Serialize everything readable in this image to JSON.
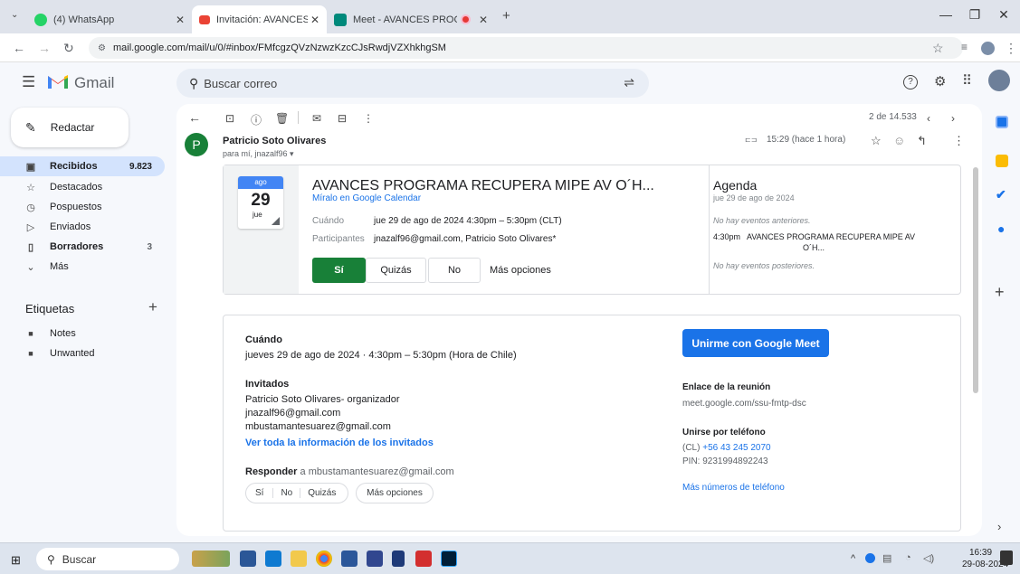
{
  "browser": {
    "tabs": [
      {
        "title": "(4) WhatsApp",
        "icon_color": "#25d366",
        "active": false
      },
      {
        "title": "Invitación: AVANCES PROGRAM",
        "icon_color": "#ea4335",
        "active": true
      },
      {
        "title": "Meet - AVANCES PROGRAM",
        "icon_color": "#00897b",
        "active": false
      }
    ],
    "new_tab": "+",
    "url": "mail.google.com/mail/u/0/#inbox/FMfcgzQVzNzwzKzcCJsRwdjVZXhkhgSM"
  },
  "gmail": {
    "logo_text": "Gmail",
    "search_placeholder": "Buscar correo"
  },
  "sidebar": {
    "compose": "Redactar",
    "items": [
      {
        "label": "Recibidos",
        "count": "9.823",
        "icon": "inbox-icon",
        "selected": true
      },
      {
        "label": "Destacados",
        "count": "",
        "icon": "star-icon"
      },
      {
        "label": "Pospuestos",
        "count": "",
        "icon": "clock-icon"
      },
      {
        "label": "Enviados",
        "count": "",
        "icon": "send-icon"
      },
      {
        "label": "Borradores",
        "count": "3",
        "icon": "draft-icon"
      },
      {
        "label": "Más",
        "count": "",
        "icon": "chevron-down-icon"
      }
    ],
    "labels_heading": "Etiquetas",
    "labels_add": "+",
    "labels": [
      {
        "label": "Notes"
      },
      {
        "label": "Unwanted"
      }
    ]
  },
  "toolbar": {
    "pagination": "2 de 14.533"
  },
  "message": {
    "avatar_letter": "P",
    "sender": "Patricio Soto Olivares",
    "recipient": "para mí, jnazalf96",
    "time": "15:29 (hace 1 hora)"
  },
  "invite": {
    "cal_month": "ago",
    "cal_day": "29",
    "cal_weekday": "jue",
    "title": "AVANCES PROGRAMA RECUPERA MIPE AV O´H...",
    "calendar_link": "Míralo en Google Calendar",
    "when_label": "Cuándo",
    "when_value": "jue 29 de ago de 2024 4:30pm – 5:30pm (CLT)",
    "participants_label": "Participantes",
    "participants_value": "jnazalf96@gmail.com, Patricio Soto Olivares*",
    "rsvp": {
      "yes": "Sí",
      "maybe": "Quizás",
      "no": "No",
      "more": "Más opciones"
    },
    "agenda": {
      "title": "Agenda",
      "date": "jue 29 de ago de 2024",
      "prev": "No hay eventos anteriores.",
      "event_time": "4:30pm",
      "event_title_line1": "AVANCES PROGRAMA RECUPERA MIPE AV",
      "event_title_line2": "O´H...",
      "next": "No hay eventos posteriores."
    }
  },
  "details": {
    "when_heading": "Cuándo",
    "when_value": "jueves 29 de ago de 2024 · 4:30pm – 5:30pm (Hora de Chile)",
    "guests_heading": "Invitados",
    "guests": [
      "Patricio Soto Olivares- organizador",
      "jnazalf96@gmail.com",
      "mbustamantesuarez@gmail.com"
    ],
    "guests_link": "Ver toda la información de los invitados",
    "reply_bold": "Responder",
    "reply_rest": "a mbustamantesuarez@gmail.com",
    "reply_buttons": {
      "yes": "Sí",
      "no": "No",
      "maybe": "Quizás",
      "more": "Más opciones"
    },
    "meet_button": "Unirme con Google Meet",
    "meeting_link_heading": "Enlace de la reunión",
    "meeting_link": "meet.google.com/ssu-fmtp-dsc",
    "phone_heading": "Unirse por teléfono",
    "phone_prefix": "(CL)",
    "phone_number": "+56 43 245 2070",
    "pin": "PIN: 9231994892243",
    "more_numbers": "Más números de teléfono"
  },
  "taskbar": {
    "search": "Buscar",
    "time": "16:39",
    "date": "29-08-2024"
  },
  "colors": {
    "accent": "#1a73e8",
    "yes_green": "#188038",
    "selected_nav": "#d3e3fd",
    "avatar": "#188038"
  }
}
